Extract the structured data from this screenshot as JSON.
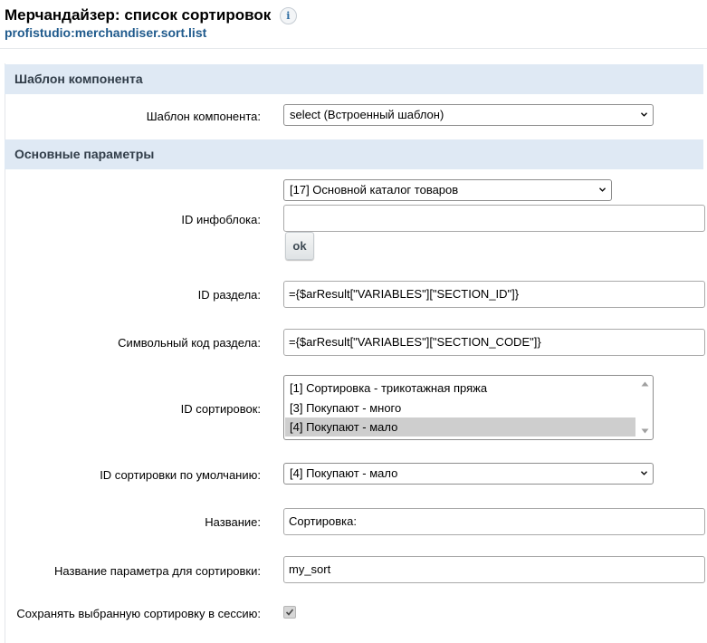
{
  "header": {
    "title": "Мерчандайзер: список сортировок",
    "info_icon": "i",
    "component_code": "profistudio:merchandiser.sort.list"
  },
  "sections": {
    "template": {
      "title": "Шаблон компонента",
      "template_label": "Шаблон компонента:",
      "template_value": "select (Встроенный шаблон)"
    },
    "main": {
      "title": "Основные параметры",
      "iblock_label": "ID инфоблока:",
      "iblock_select": "[17] Основной каталог товаров",
      "iblock_input": "",
      "ok_label": "ok",
      "section_id_label": "ID раздела:",
      "section_id_value": "={$arResult[\"VARIABLES\"][\"SECTION_ID\"]}",
      "section_code_label": "Символьный код раздела:",
      "section_code_value": "={$arResult[\"VARIABLES\"][\"SECTION_CODE\"]}",
      "sort_ids_label": "ID сортировок:",
      "sort_ids_options": [
        {
          "label": "[1] Сортировка - трикотажная пряжа",
          "selected": false
        },
        {
          "label": "[3] Покупают - много",
          "selected": false
        },
        {
          "label": "[4] Покупают - мало",
          "selected": true
        }
      ],
      "default_sort_label": "ID сортировки по умолчанию:",
      "default_sort_value": "[4] Покупают - мало",
      "name_label": "Название:",
      "name_value": "Сортировка:",
      "param_name_label": "Название параметра для сортировки:",
      "param_name_value": "my_sort",
      "save_session_label": "Сохранять выбранную сортировку в сессию:",
      "save_session_checked": true
    }
  },
  "colors": {
    "section_header_bg": "#dfe9f4",
    "subtitle": "#1f5a8c"
  }
}
